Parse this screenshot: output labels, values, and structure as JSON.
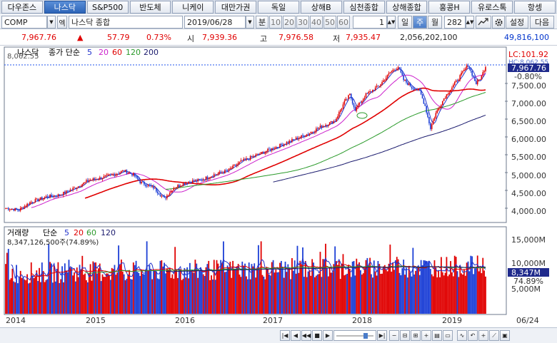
{
  "tabs": [
    {
      "label": "다우존스",
      "active": false
    },
    {
      "label": "나스닥",
      "active": true
    },
    {
      "label": "S&P500",
      "active": false
    },
    {
      "label": "반도체",
      "active": false
    },
    {
      "label": "니케이",
      "active": false
    },
    {
      "label": "대만가권",
      "active": false
    },
    {
      "label": "독일",
      "active": false
    },
    {
      "label": "상해B",
      "active": false
    },
    {
      "label": "심천종합",
      "active": false
    },
    {
      "label": "상해종합",
      "active": false
    },
    {
      "label": "홍콩H",
      "active": false
    },
    {
      "label": "유로스톡",
      "active": false
    },
    {
      "label": "항셍",
      "active": false
    }
  ],
  "controls": {
    "symbol": "COMP",
    "symbol_btn": "엑",
    "name": "나스닥 종합",
    "date": "2019/06/28",
    "period_buttons": [
      "분",
      "10",
      "20",
      "30",
      "40",
      "50",
      "60"
    ],
    "multiplier": "1",
    "day": "일",
    "week": "주",
    "month": "월",
    "count": "282",
    "settings": "설정",
    "next": "다음"
  },
  "price": {
    "close": "7,967.76",
    "change_arrow": "▲",
    "change": "57.79",
    "change_pct": "0.73%",
    "open_label": "시",
    "open": "7,939.36",
    "high_label": "고",
    "high": "7,976.58",
    "low_label": "저",
    "low": "7,935.47",
    "volume": "2,056,202,100",
    "value": "49,816,100"
  },
  "main_legend": {
    "title": "나스닥",
    "ma": "종가 단순",
    "periods": [
      "5",
      "20",
      "60",
      "120",
      "200"
    ],
    "sub": "8,062.55"
  },
  "main_axis": {
    "ticks": [
      "7,500.00",
      "7,000.00",
      "6,500.00",
      "6,000.00",
      "5,500.00",
      "5,000.00",
      "4,500.00",
      "4,000.00"
    ],
    "lc": "LC:101.92",
    "hc": "HC:8,062.55",
    "last": "7,967.76",
    "last_pct": "-0.80%"
  },
  "volume_legend": {
    "title": "거래량",
    "ma": "단순",
    "periods": [
      "5",
      "20",
      "60",
      "120"
    ],
    "sub": "8,347,126,500주(74.89%)"
  },
  "volume_axis": {
    "ticks": [
      "15,000M",
      "10,000M",
      "5,000M"
    ],
    "last": "8,347M",
    "last_pct": "74.89%"
  },
  "x_axis": {
    "labels": [
      "2014",
      "2015",
      "2016",
      "2017",
      "2018",
      "2019"
    ],
    "right": "06/24"
  },
  "colors": {
    "up": "#e00000",
    "down": "#1c3fd6",
    "ma5": "#2233cc",
    "ma20": "#cc22cc",
    "ma60": "#e00000",
    "ma120": "#2a9a2a",
    "ma200": "#1b1b6e",
    "active_tab": "#2d64b8"
  },
  "chart_data": {
    "type": "candlestick",
    "series": [
      {
        "name": "나스닥",
        "x": [
          "2014",
          "2015",
          "2016",
          "2017",
          "2018",
          "2019",
          "06/24"
        ],
        "values": [
          4150,
          4700,
          4950,
          5500,
          7200,
          6800,
          7967.76
        ]
      }
    ],
    "ylim": [
      3800,
      8100
    ]
  }
}
